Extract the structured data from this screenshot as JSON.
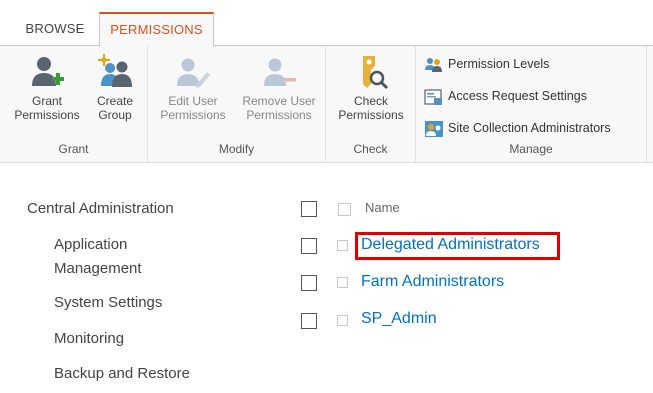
{
  "tabs": [
    {
      "label": "BROWSE"
    },
    {
      "label": "PERMISSIONS"
    }
  ],
  "ribbon": {
    "grant": {
      "label": "Grant",
      "grant_permissions": "Grant\nPermissions",
      "create_group": "Create\nGroup"
    },
    "modify": {
      "label": "Modify",
      "edit_user_permissions": "Edit User\nPermissions",
      "remove_user_permissions": "Remove User\nPermissions"
    },
    "check": {
      "label": "Check",
      "check_permissions": "Check\nPermissions"
    },
    "manage": {
      "label": "Manage",
      "permission_levels": "Permission Levels",
      "access_request_settings": "Access Request Settings",
      "site_collection_administrators": "Site Collection Administrators"
    }
  },
  "nav": {
    "root": "Central Administration",
    "items": [
      {
        "label": "Application\nManagement"
      },
      {
        "label": "System Settings"
      },
      {
        "label": "Monitoring"
      },
      {
        "label": "Backup and Restore"
      }
    ]
  },
  "list": {
    "column_header": "Name",
    "rows": [
      {
        "name": "Delegated Administrators"
      },
      {
        "name": "Farm Administrators"
      },
      {
        "name": "SP_Admin"
      }
    ]
  },
  "colors": {
    "accent": "#d8531b",
    "link": "#0072c6",
    "highlight": "#e00000"
  }
}
